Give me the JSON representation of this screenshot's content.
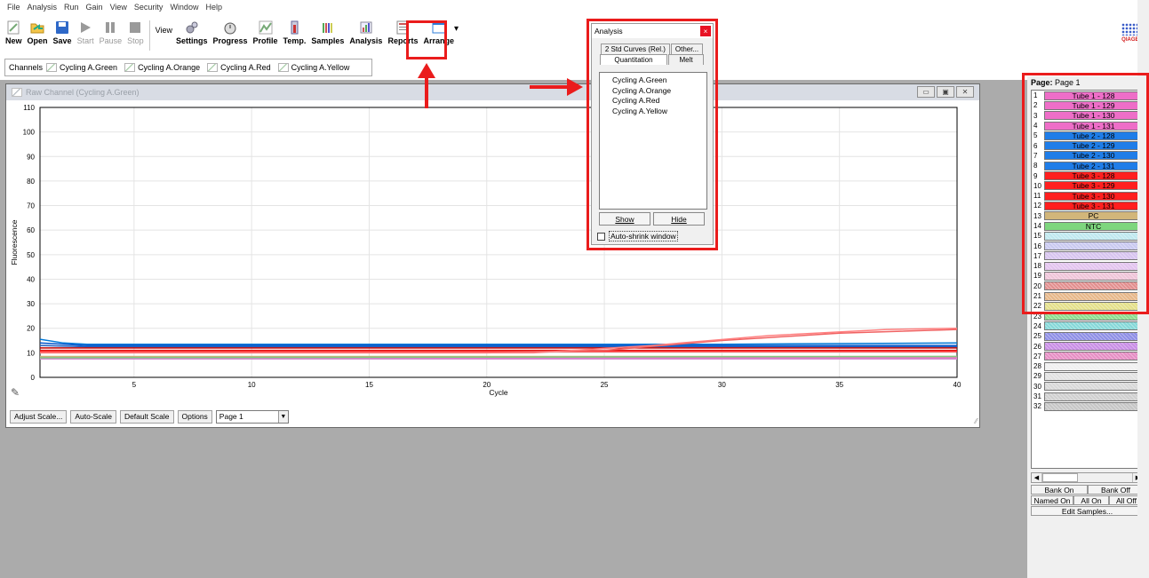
{
  "menu": [
    "File",
    "Analysis",
    "Run",
    "Gain",
    "View",
    "Security",
    "Window",
    "Help"
  ],
  "toolbar": {
    "group1": [
      {
        "id": "new",
        "label": "New",
        "icon": "new-file-icon",
        "enabled": true
      },
      {
        "id": "open",
        "label": "Open",
        "icon": "open-folder-icon",
        "enabled": true
      },
      {
        "id": "save",
        "label": "Save",
        "icon": "save-disk-icon",
        "enabled": true
      },
      {
        "id": "start",
        "label": "Start",
        "icon": "play-icon",
        "enabled": false
      },
      {
        "id": "pause",
        "label": "Pause",
        "icon": "pause-icon",
        "enabled": false
      },
      {
        "id": "stop",
        "label": "Stop",
        "icon": "stop-icon",
        "enabled": false
      }
    ],
    "view_label": "View",
    "group2": [
      {
        "id": "settings",
        "label": "Settings",
        "icon": "gears-icon"
      },
      {
        "id": "progress",
        "label": "Progress",
        "icon": "stopwatch-icon"
      },
      {
        "id": "profile",
        "label": "Profile",
        "icon": "profile-chart-icon"
      },
      {
        "id": "temp",
        "label": "Temp.",
        "icon": "thermometer-icon"
      },
      {
        "id": "samples",
        "label": "Samples",
        "icon": "tubes-icon"
      },
      {
        "id": "analysis",
        "label": "Analysis",
        "icon": "analysis-chart-icon"
      },
      {
        "id": "reports",
        "label": "Reports",
        "icon": "report-icon"
      },
      {
        "id": "arrange",
        "label": "Arrange",
        "icon": "windows-icon"
      }
    ],
    "logo_text": "QIAGEN"
  },
  "channels": {
    "label": "Channels",
    "items": [
      "Cycling A.Green",
      "Cycling A.Orange",
      "Cycling A.Red",
      "Cycling A.Yellow"
    ]
  },
  "raw_window": {
    "title": "Raw Channel (Cycling A.Green)",
    "controls": {
      "adjust": "Adjust Scale...",
      "auto": "Auto-Scale",
      "default": "Default Scale",
      "options": "Options",
      "page_select": "Page 1"
    }
  },
  "chart_data": {
    "type": "line",
    "xlabel": "Cycle",
    "ylabel": "Fluorescence",
    "xlim": [
      1,
      40
    ],
    "ylim": [
      0,
      110
    ],
    "xticks": [
      5,
      10,
      15,
      20,
      25,
      30,
      35,
      40
    ],
    "yticks": [
      0,
      10,
      20,
      30,
      40,
      50,
      60,
      70,
      80,
      90,
      100,
      110
    ],
    "grid": true,
    "series": [
      {
        "color": "#0078d7",
        "values": [
          [
            1,
            15.5
          ],
          [
            2,
            14
          ],
          [
            3,
            13.5
          ],
          [
            10,
            13.5
          ],
          [
            20,
            13.5
          ],
          [
            30,
            13.5
          ],
          [
            40,
            14
          ]
        ]
      },
      {
        "color": "#0055cc",
        "values": [
          [
            1,
            14
          ],
          [
            3,
            13
          ],
          [
            20,
            13
          ],
          [
            40,
            13
          ]
        ]
      },
      {
        "color": "#1f5fbf",
        "values": [
          [
            1,
            13
          ],
          [
            3,
            12.5
          ],
          [
            40,
            12.5
          ]
        ]
      },
      {
        "color": "#e01010",
        "values": [
          [
            1,
            11
          ],
          [
            40,
            11
          ]
        ]
      },
      {
        "color": "#c00000",
        "values": [
          [
            1,
            12
          ],
          [
            40,
            12
          ]
        ]
      },
      {
        "color": "#ff3030",
        "values": [
          [
            1,
            10.5
          ],
          [
            40,
            10.5
          ]
        ]
      },
      {
        "color": "#f06262",
        "values": [
          [
            1,
            10
          ],
          [
            20,
            10
          ],
          [
            25,
            11
          ],
          [
            30,
            15
          ],
          [
            35,
            18
          ],
          [
            40,
            19.5
          ]
        ]
      },
      {
        "color": "#ff7f7f",
        "values": [
          [
            1,
            10
          ],
          [
            22,
            10
          ],
          [
            27,
            13
          ],
          [
            32,
            17
          ],
          [
            37,
            19.5
          ],
          [
            40,
            20
          ]
        ]
      },
      {
        "color": "#ee6ec8",
        "values": [
          [
            1,
            8
          ],
          [
            40,
            8
          ]
        ]
      },
      {
        "color": "#d08cd0",
        "values": [
          [
            1,
            7.5
          ],
          [
            40,
            7.5
          ]
        ]
      },
      {
        "color": "#c8b27a",
        "values": [
          [
            1,
            8.5
          ],
          [
            40,
            8.5
          ]
        ]
      },
      {
        "color": "#80c880",
        "values": [
          [
            1,
            8
          ],
          [
            40,
            8.5
          ]
        ]
      }
    ]
  },
  "analysis_panel": {
    "title": "Analysis",
    "close": "×",
    "tabs_top": [
      "2 Std Curves (Rel.)",
      "Other..."
    ],
    "tabs_bottom": [
      "Quantitation",
      "Melt"
    ],
    "list": [
      "Cycling A.Green",
      "Cycling A.Orange",
      "Cycling A.Red",
      "Cycling A.Yellow"
    ],
    "show": "Show",
    "hide": "Hide",
    "auto_shrink": "Auto-shrink window"
  },
  "samples": {
    "page_label": "Page:",
    "page_value": "Page 1",
    "rows": [
      {
        "n": "1",
        "name": "Tube 1 - 128",
        "color": "#ee6ec8"
      },
      {
        "n": "2",
        "name": "Tube 1 - 129",
        "color": "#ee6ec8"
      },
      {
        "n": "3",
        "name": "Tube 1 - 130",
        "color": "#ee6ec8"
      },
      {
        "n": "4",
        "name": "Tube 1 - 131",
        "color": "#ee6ec8"
      },
      {
        "n": "5",
        "name": "Tube 2 - 128",
        "color": "#1f7de8"
      },
      {
        "n": "6",
        "name": "Tube 2 - 129",
        "color": "#1f7de8"
      },
      {
        "n": "7",
        "name": "Tube 2 - 130",
        "color": "#1f7de8"
      },
      {
        "n": "8",
        "name": "Tube 2 - 131",
        "color": "#1f7de8"
      },
      {
        "n": "9",
        "name": "Tube 3 - 128",
        "color": "#ff1f1f"
      },
      {
        "n": "10",
        "name": "Tube 3 - 129",
        "color": "#ff1f1f"
      },
      {
        "n": "11",
        "name": "Tube 3 - 130",
        "color": "#ff1f1f"
      },
      {
        "n": "12",
        "name": "Tube 3 - 131",
        "color": "#ff1f1f"
      },
      {
        "n": "13",
        "name": "PC",
        "color": "#d2b67a"
      },
      {
        "n": "14",
        "name": "NTC",
        "color": "#7ed67e"
      },
      {
        "n": "15",
        "name": "",
        "color": "#bfe8ef"
      },
      {
        "n": "16",
        "name": "",
        "color": "#c9c9f0"
      },
      {
        "n": "17",
        "name": "",
        "color": "#d7c4ef"
      },
      {
        "n": "18",
        "name": "",
        "color": "#e3c4ef"
      },
      {
        "n": "19",
        "name": "",
        "color": "#efc4d8"
      },
      {
        "n": "20",
        "name": "",
        "color": "#e28f8f"
      },
      {
        "n": "21",
        "name": "",
        "color": "#e7b88a"
      },
      {
        "n": "22",
        "name": "",
        "color": "#e4e08a"
      },
      {
        "n": "23",
        "name": "",
        "color": "#8edb8e"
      },
      {
        "n": "24",
        "name": "",
        "color": "#86d8d8"
      },
      {
        "n": "25",
        "name": "",
        "color": "#8f8fe6"
      },
      {
        "n": "26",
        "name": "",
        "color": "#c98ee6"
      },
      {
        "n": "27",
        "name": "",
        "color": "#e68ec4"
      },
      {
        "n": "28",
        "name": "",
        "color": "#f0f0f0"
      },
      {
        "n": "29",
        "name": "",
        "color": "#e2e2e2"
      },
      {
        "n": "30",
        "name": "",
        "color": "#d8d8d8"
      },
      {
        "n": "31",
        "name": "",
        "color": "#cfcfcf"
      },
      {
        "n": "32",
        "name": "",
        "color": "#c6c6c6"
      }
    ],
    "bank_on": "Bank On",
    "bank_off": "Bank Off",
    "named_on": "Named On",
    "all_on": "All On",
    "all_off": "All Off",
    "edit": "Edit Samples..."
  },
  "annotation_colors": {
    "highlight": "#ea1c1c"
  }
}
